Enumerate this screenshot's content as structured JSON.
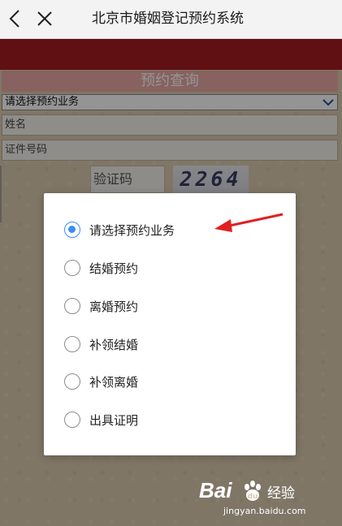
{
  "topbar": {
    "title": "北京市婚姻登记预约系统",
    "back_icon": "chevron-left-icon",
    "close_icon": "close-icon"
  },
  "form": {
    "title": "预约查询",
    "business_select": "请选择预约业务",
    "name_placeholder": "姓名",
    "id_placeholder": "证件号码",
    "captcha_label": "验证码",
    "captcha_code": "2264"
  },
  "dialog": {
    "options": [
      {
        "label": "请选择预约业务",
        "checked": true
      },
      {
        "label": "结婚预约",
        "checked": false
      },
      {
        "label": "离婚预约",
        "checked": false
      },
      {
        "label": "补领结婚",
        "checked": false
      },
      {
        "label": "补领离婚",
        "checked": false
      },
      {
        "label": "出具证明",
        "checked": false
      }
    ]
  },
  "annotation": {
    "arrow_color": "#e02020"
  },
  "watermark": {
    "brand": "Bai",
    "brand_cn": "经验",
    "url": "jingyan.baidu.com"
  },
  "colors": {
    "banner": "#a61c1f",
    "radio_accent": "#3d8ef0"
  }
}
